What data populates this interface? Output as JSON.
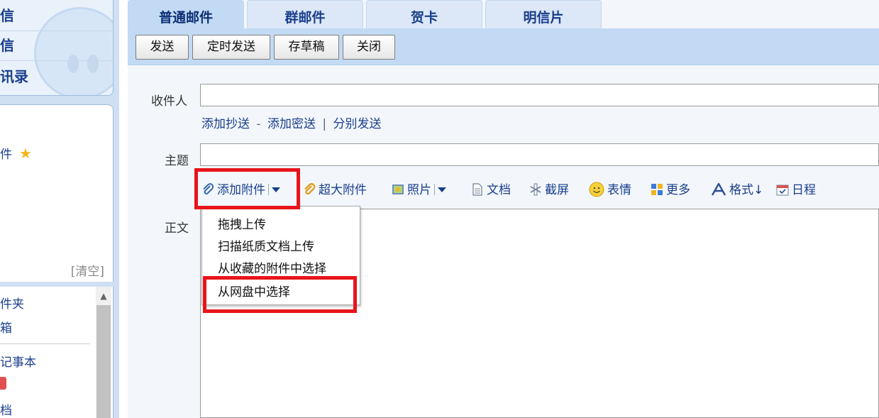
{
  "sidebar": {
    "top_links": [
      "信",
      "信",
      "讯录"
    ],
    "star_item": "件",
    "clear_label": "[清空]",
    "folder_items": [
      "件夹",
      "箱",
      "记事本",
      "档"
    ]
  },
  "tabs": [
    "普通邮件",
    "群邮件",
    "贺卡",
    "明信片"
  ],
  "toolbar": {
    "send": "发送",
    "scheduled_send": "定时发送",
    "save_draft": "存草稿",
    "close": "关闭"
  },
  "form": {
    "recipient_label": "收件人",
    "add_cc": "添加抄送",
    "dash": "-",
    "add_bcc": "添加密送",
    "pipe": "|",
    "separate_send": "分别发送",
    "subject_label": "主题",
    "body_label": "正文"
  },
  "attach_bar": {
    "add_attachment": "添加附件",
    "large_attachment": "超大附件",
    "photo": "照片",
    "document": "文档",
    "screenshot": "截屏",
    "emoji": "表情",
    "more": "更多",
    "format": "格式↓",
    "schedule": "日程"
  },
  "dropdown": {
    "items": [
      "拖拽上传",
      "扫描纸质文档上传",
      "从收藏的附件中选择",
      "从网盘中选择"
    ]
  },
  "colors": {
    "link": "#1a3e8c",
    "highlight": "#e8141b",
    "toolbar_bg": "#c3daf4"
  }
}
